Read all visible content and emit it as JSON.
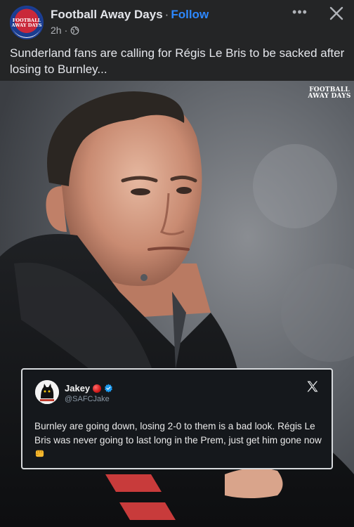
{
  "post": {
    "page_name": "Football Away Days",
    "separator": "·",
    "follow_label": "Follow",
    "time": "2h",
    "dot": "·",
    "audience_icon": "globe-icon",
    "caption": "Sunderland fans are calling for Régis Le Bris to be sacked after losing to Burnley...",
    "avatar_text": "FOOTBALL AWAY DAYS"
  },
  "photo": {
    "watermark": "FOOTBALL AWAY DAYS"
  },
  "tweet": {
    "name": "Jakey",
    "handle": "@SAFCJake",
    "text": "Burnley are going down, losing 2-0 to them is a bad look. Régis Le Bris was never going to last long in the Prem, just get him gone now",
    "emoji_icon": "fist-icon",
    "verified_icon": "verified-icon",
    "badge_icon": "red-dot-icon"
  },
  "colors": {
    "background": "#242526",
    "link": "#2d88ff",
    "tweet_bg": "#15181c",
    "verified": "#1d9bf0"
  }
}
